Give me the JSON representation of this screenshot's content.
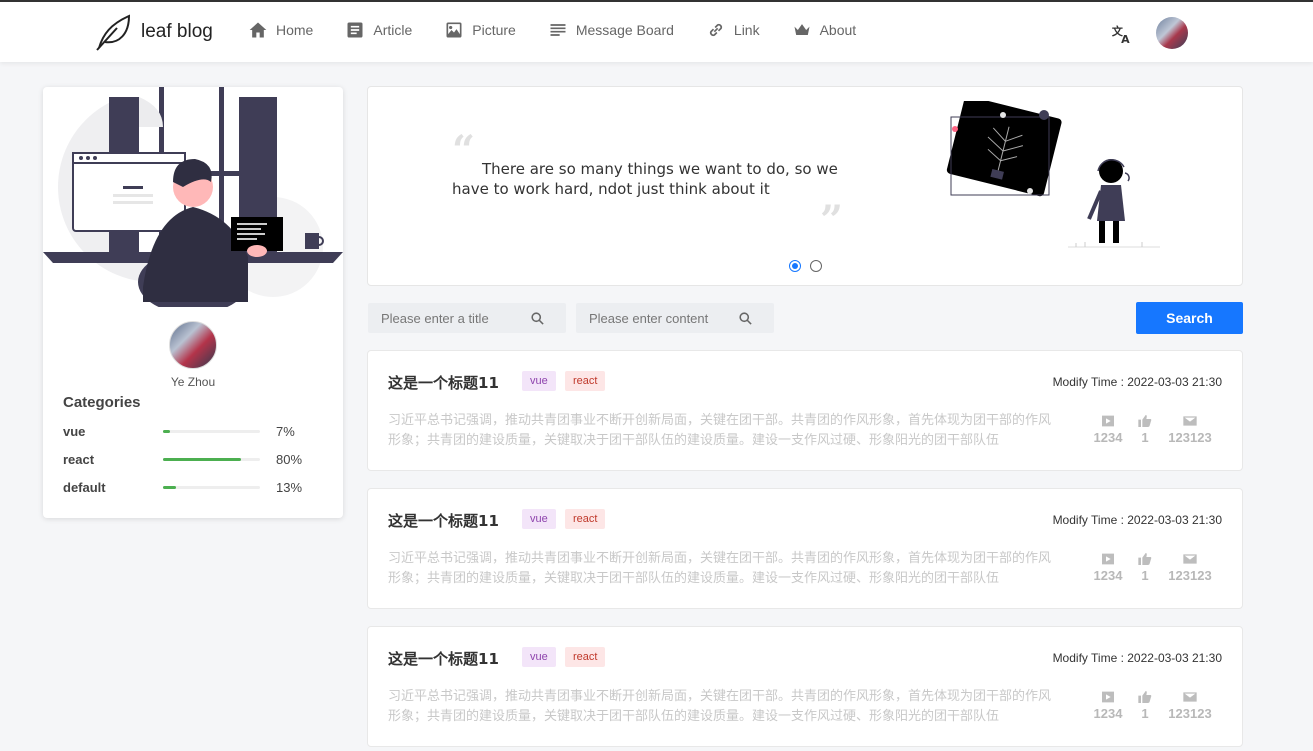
{
  "header": {
    "logo_text": "leaf blog",
    "nav": [
      {
        "label": "Home",
        "icon": "home-icon"
      },
      {
        "label": "Article",
        "icon": "article-icon"
      },
      {
        "label": "Picture",
        "icon": "picture-icon"
      },
      {
        "label": "Message Board",
        "icon": "message-board-icon"
      },
      {
        "label": "Link",
        "icon": "link-icon"
      },
      {
        "label": "About",
        "icon": "crown-icon"
      }
    ]
  },
  "profile": {
    "name": "Ye Zhou",
    "categories_title": "Categories",
    "categories": [
      {
        "name": "vue",
        "percent": "7%",
        "value": 7
      },
      {
        "name": "react",
        "percent": "80%",
        "value": 80
      },
      {
        "name": "default",
        "percent": "13%",
        "value": 13
      }
    ]
  },
  "banner": {
    "quote": "There are so many things we want to do, so we have to work hard, ndot just think about it"
  },
  "search": {
    "title_placeholder": "Please enter a title",
    "content_placeholder": "Please enter content",
    "button_label": "Search"
  },
  "articles": [
    {
      "title": "这是一个标题11",
      "tags": [
        "vue",
        "react"
      ],
      "time": "Modify Time : 2022-03-03 21:30",
      "desc": "习近平总书记强调，推动共青团事业不断开创新局面，关键在团干部。共青团的作风形象，首先体现为团干部的作风形象；共青团的建设质量，关键取决于团干部队伍的建设质量。建设一支作风过硬、形象阳光的团干部队伍",
      "views": "1234",
      "likes": "1",
      "comments": "123123"
    },
    {
      "title": "这是一个标题11",
      "tags": [
        "vue",
        "react"
      ],
      "time": "Modify Time : 2022-03-03 21:30",
      "desc": "习近平总书记强调，推动共青团事业不断开创新局面，关键在团干部。共青团的作风形象，首先体现为团干部的作风形象；共青团的建设质量，关键取决于团干部队伍的建设质量。建设一支作风过硬、形象阳光的团干部队伍",
      "views": "1234",
      "likes": "1",
      "comments": "123123"
    },
    {
      "title": "这是一个标题11",
      "tags": [
        "vue",
        "react"
      ],
      "time": "Modify Time : 2022-03-03 21:30",
      "desc": "习近平总书记强调，推动共青团事业不断开创新局面，关键在团干部。共青团的作风形象，首先体现为团干部的作风形象；共青团的建设质量，关键取决于团干部队伍的建设质量。建设一支作风过硬、形象阳光的团干部队伍",
      "views": "1234",
      "likes": "1",
      "comments": "123123"
    }
  ],
  "colors": {
    "accent": "#1677ff",
    "progress": "#4caf50",
    "tag_vue_bg": "#f3e5f9",
    "tag_react_bg": "#fde6e6"
  }
}
